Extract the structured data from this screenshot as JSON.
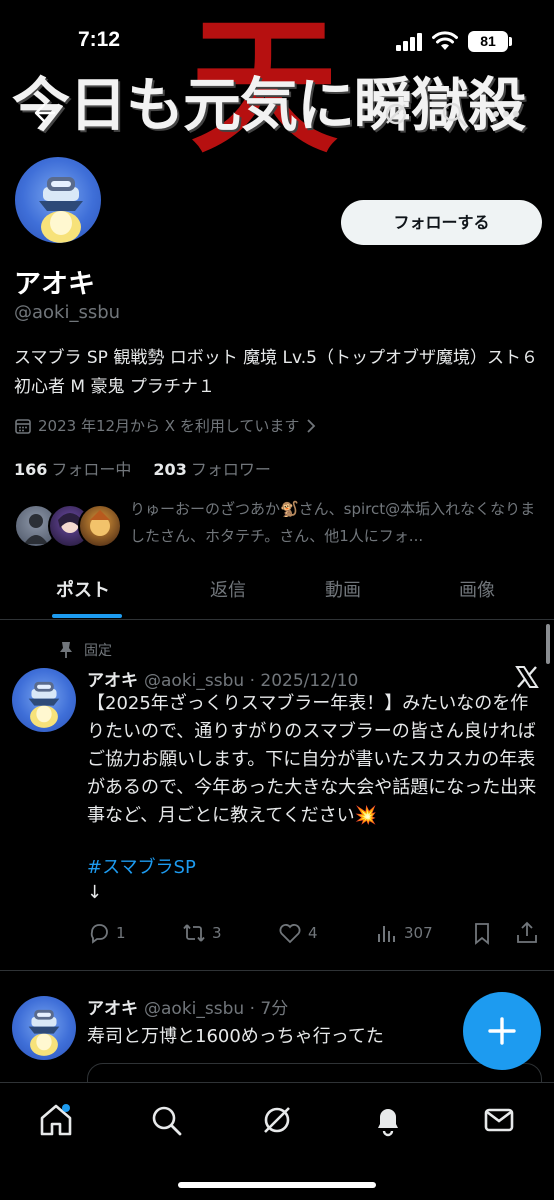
{
  "status_bar": {
    "time": "7:12",
    "battery": "81"
  },
  "banner": {
    "title": "今日も元気に瞬獄殺",
    "overlay_char": "天"
  },
  "profile": {
    "follow_label": "フォローする",
    "display_name": "アオキ",
    "handle": "@aoki_ssbu",
    "bio": "スマブラ SP 観戦勢 ロボット 魔境 Lv.5（トップオブザ魔境）スト６ 初心者 M 豪鬼 プラチナ１",
    "joined": "2023 年12月から X を利用しています",
    "following_count": "166",
    "following_label": "フォロー中",
    "followers_count": "203",
    "followers_label": "フォロワー",
    "followed_by": "りゅーおーのざつあか🐒さん、spirct@本垢入れなくなりましたさん、ホタテチ。さん、他1人にフォ..."
  },
  "tabs": [
    {
      "label": "ポスト"
    },
    {
      "label": "返信"
    },
    {
      "label": "動画"
    },
    {
      "label": "画像"
    }
  ],
  "tweets": [
    {
      "pinned_label": "固定",
      "name": "アオキ",
      "handle_date": "@aoki_ssbu · 2025/12/10",
      "text": "【2025年ざっくりスマブラー年表！】みたいなのを作りたいので、通りすがりのスマブラーの皆さん良ければご協力お願いします。下に自分が書いたスカスカの年表があるので、今年あった大きな大会や話題になった出来事など、月ごとに教えてください💥",
      "hashtag": "#スマブラSP",
      "trailing": "↓",
      "replies": "1",
      "reposts": "3",
      "likes": "4",
      "views": "307"
    },
    {
      "name": "アオキ",
      "handle_date": "@aoki_ssbu · 7分",
      "text": "寿司と万博と1600めっちゃ行ってた"
    }
  ],
  "colors": {
    "accent": "#1d9bf0",
    "background": "#000000",
    "muted": "#71767b",
    "banner_red": "#c41212"
  }
}
